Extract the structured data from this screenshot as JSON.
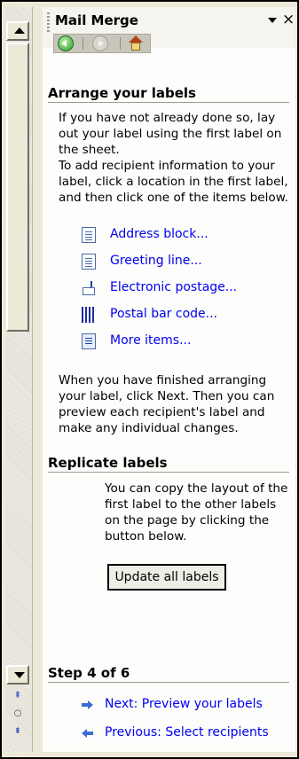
{
  "pane": {
    "title": "Mail Merge",
    "menu_icon": "dropdown-arrow",
    "close_label": "×"
  },
  "nav": {
    "back_icon": "back-arrow-icon",
    "forward_icon": "forward-arrow-icon",
    "home_icon": "home-icon"
  },
  "arrange": {
    "title": "Arrange your labels",
    "para1": "If you have not already done so, lay out your label using the first label on the sheet.",
    "para2": "To add recipient information to your label, click a location in the first label, and then click one of the items below.",
    "links": [
      {
        "label": "Address block...",
        "icon": "address-block-icon"
      },
      {
        "label": "Greeting line...",
        "icon": "greeting-line-icon"
      },
      {
        "label": "Electronic postage...",
        "icon": "postage-icon"
      },
      {
        "label": "Postal bar code...",
        "icon": "barcode-icon"
      },
      {
        "label": "More items...",
        "icon": "more-items-icon"
      }
    ],
    "para3": "When you have finished arranging your label, click Next. Then you can preview each recipient's label and make any individual changes."
  },
  "replicate": {
    "title": "Replicate labels",
    "para": "You can copy the layout of the first label to the other labels on the page by clicking the button below.",
    "button_label": "Update all labels"
  },
  "step": {
    "title": "Step 4 of 6",
    "next_label": "Next: Preview your labels",
    "prev_label": "Previous: Select recipients"
  },
  "colors": {
    "link": "#0000ee",
    "pane_bg": "#fdfdfb",
    "chrome_bg": "#ece9d8"
  }
}
